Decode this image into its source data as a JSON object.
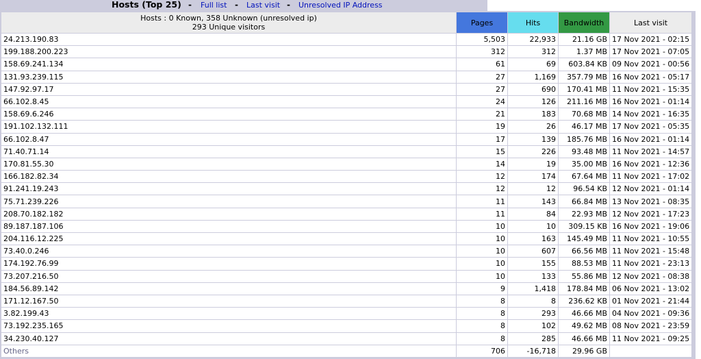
{
  "header": {
    "title": "Hosts (Top 25)",
    "sep1": "-",
    "full_list": "Full list",
    "sep2": "-",
    "last_visit": "Last visit",
    "sep3": "-",
    "unresolved": "Unresolved IP Address"
  },
  "summary": {
    "line1": "Hosts : 0 Known, 358 Unknown (unresolved ip)",
    "line2": "293 Unique visitors"
  },
  "columns": {
    "pages": "Pages",
    "hits": "Hits",
    "bandwidth": "Bandwidth",
    "last_visit": "Last visit"
  },
  "colors": {
    "pages": "#4477DD",
    "hits": "#66DDEE",
    "bandwidth": "#339944",
    "frame": "#CCCCDD",
    "link": "#0011BB"
  },
  "rows": [
    {
      "host": "24.213.190.83",
      "pages": "5,503",
      "hits": "22,933",
      "bandwidth": "21.16 GB",
      "last": "17 Nov 2021 - 02:15"
    },
    {
      "host": "199.188.200.223",
      "pages": "312",
      "hits": "312",
      "bandwidth": "1.37 MB",
      "last": "17 Nov 2021 - 07:05"
    },
    {
      "host": "158.69.241.134",
      "pages": "61",
      "hits": "69",
      "bandwidth": "603.84 KB",
      "last": "09 Nov 2021 - 00:56"
    },
    {
      "host": "131.93.239.115",
      "pages": "27",
      "hits": "1,169",
      "bandwidth": "357.79 MB",
      "last": "16 Nov 2021 - 05:17"
    },
    {
      "host": "147.92.97.17",
      "pages": "27",
      "hits": "690",
      "bandwidth": "170.41 MB",
      "last": "11 Nov 2021 - 15:35"
    },
    {
      "host": "66.102.8.45",
      "pages": "24",
      "hits": "126",
      "bandwidth": "211.16 MB",
      "last": "16 Nov 2021 - 01:14"
    },
    {
      "host": "158.69.6.246",
      "pages": "21",
      "hits": "183",
      "bandwidth": "70.68 MB",
      "last": "14 Nov 2021 - 16:35"
    },
    {
      "host": "191.102.132.111",
      "pages": "19",
      "hits": "26",
      "bandwidth": "46.17 MB",
      "last": "17 Nov 2021 - 05:35"
    },
    {
      "host": "66.102.8.47",
      "pages": "17",
      "hits": "139",
      "bandwidth": "185.76 MB",
      "last": "16 Nov 2021 - 01:14"
    },
    {
      "host": "71.40.71.14",
      "pages": "15",
      "hits": "226",
      "bandwidth": "93.48 MB",
      "last": "11 Nov 2021 - 14:57"
    },
    {
      "host": "170.81.55.30",
      "pages": "14",
      "hits": "19",
      "bandwidth": "35.00 MB",
      "last": "16 Nov 2021 - 12:36"
    },
    {
      "host": "166.182.82.34",
      "pages": "12",
      "hits": "174",
      "bandwidth": "67.64 MB",
      "last": "11 Nov 2021 - 17:02"
    },
    {
      "host": "91.241.19.243",
      "pages": "12",
      "hits": "12",
      "bandwidth": "96.54 KB",
      "last": "12 Nov 2021 - 01:14"
    },
    {
      "host": "75.71.239.226",
      "pages": "11",
      "hits": "143",
      "bandwidth": "66.84 MB",
      "last": "13 Nov 2021 - 08:35"
    },
    {
      "host": "208.70.182.182",
      "pages": "11",
      "hits": "84",
      "bandwidth": "22.93 MB",
      "last": "12 Nov 2021 - 17:23"
    },
    {
      "host": "89.187.187.106",
      "pages": "10",
      "hits": "10",
      "bandwidth": "309.15 KB",
      "last": "16 Nov 2021 - 19:06"
    },
    {
      "host": "204.116.12.225",
      "pages": "10",
      "hits": "163",
      "bandwidth": "145.49 MB",
      "last": "11 Nov 2021 - 10:55"
    },
    {
      "host": "73.40.0.246",
      "pages": "10",
      "hits": "607",
      "bandwidth": "66.56 MB",
      "last": "11 Nov 2021 - 15:48"
    },
    {
      "host": "174.192.76.99",
      "pages": "10",
      "hits": "155",
      "bandwidth": "88.53 MB",
      "last": "11 Nov 2021 - 23:13"
    },
    {
      "host": "73.207.216.50",
      "pages": "10",
      "hits": "133",
      "bandwidth": "55.86 MB",
      "last": "12 Nov 2021 - 08:38"
    },
    {
      "host": "184.56.89.142",
      "pages": "9",
      "hits": "1,418",
      "bandwidth": "178.84 MB",
      "last": "06 Nov 2021 - 13:02"
    },
    {
      "host": "171.12.167.50",
      "pages": "8",
      "hits": "8",
      "bandwidth": "236.62 KB",
      "last": "01 Nov 2021 - 21:44"
    },
    {
      "host": "3.82.199.43",
      "pages": "8",
      "hits": "293",
      "bandwidth": "46.66 MB",
      "last": "04 Nov 2021 - 09:36"
    },
    {
      "host": "73.192.235.165",
      "pages": "8",
      "hits": "102",
      "bandwidth": "49.62 MB",
      "last": "08 Nov 2021 - 23:59"
    },
    {
      "host": "34.230.40.127",
      "pages": "8",
      "hits": "285",
      "bandwidth": "46.66 MB",
      "last": "11 Nov 2021 - 09:25"
    }
  ],
  "others": {
    "host": "Others",
    "pages": "706",
    "hits": "-16,718",
    "bandwidth": "29.96 GB",
    "last": ""
  }
}
